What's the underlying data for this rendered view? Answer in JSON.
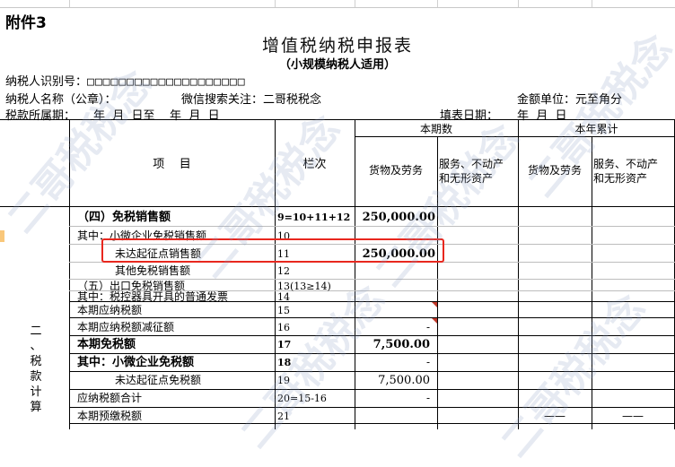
{
  "sheet_label": "附件3",
  "title": "增值税纳税申报表",
  "subtitle": "（小规模纳税人适用）",
  "info": {
    "taxpayer_id_label": "纳税人识别号：",
    "taxpayer_id_boxes": "□□□□□□□□□□□□□□□□□□□□",
    "taxpayer_name_label": "纳税人名称（公章）：",
    "wechat_note": "微信搜索关注：二哥税税念",
    "currency_unit": "金额单位：元至角分",
    "period_label": "税款所属期：",
    "period_value": "年  月  日至    年  月  日",
    "fill_date_label": "填表日期：",
    "fill_date_value": "年  月  日"
  },
  "table": {
    "header_current": "本期数",
    "header_ytd": "本年累计",
    "header_item": "项    目",
    "header_lineno": "栏次",
    "header_goods": "货物及劳务",
    "header_service_line1": "服务、不动产",
    "header_service_line2": "和无形资产",
    "side_label": [
      "二",
      "、",
      "税",
      "款",
      "计",
      "算"
    ],
    "rows": [
      {
        "item": "（四）免税销售额",
        "line": "9=10+11+12",
        "goods": "250,000.00",
        "bold": true
      },
      {
        "item": "其中：小微企业免税销售额",
        "line": "10",
        "goods": ""
      },
      {
        "item": "未达起征点销售额",
        "line": "11",
        "goods": "250,000.00",
        "bold_value": true
      },
      {
        "item": "其他免税销售额",
        "line": "12",
        "goods": ""
      },
      {
        "item": "（五）出口免税销售额",
        "line": "13(13≥14)",
        "goods": ""
      },
      {
        "item": "其中：税控器具开具的普通发票",
        "line": "14",
        "goods": ""
      },
      {
        "item": "本期应纳税额",
        "line": "15",
        "goods": ""
      },
      {
        "item": "本期应纳税额减征额",
        "line": "16",
        "goods": "-"
      },
      {
        "item": "本期免税额",
        "line": "17",
        "goods": "7,500.00",
        "bold": true
      },
      {
        "item": "其中：小微企业免税额",
        "line": "18",
        "goods": "-",
        "bold": true
      },
      {
        "item": "未达起征点免税额",
        "line": "19",
        "goods": "7,500.00"
      },
      {
        "item": "应纳税额合计",
        "line": "20=15-16",
        "goods": "-"
      },
      {
        "item": "本期预缴税额",
        "line": "21",
        "goods": "",
        "ytd_goods": "——",
        "ytd_service": "——"
      }
    ]
  },
  "watermark": "二哥税税念",
  "colors": {
    "highlight_border": "#e8271e",
    "grid": "#000000",
    "row_marker": "#f9c77a"
  }
}
